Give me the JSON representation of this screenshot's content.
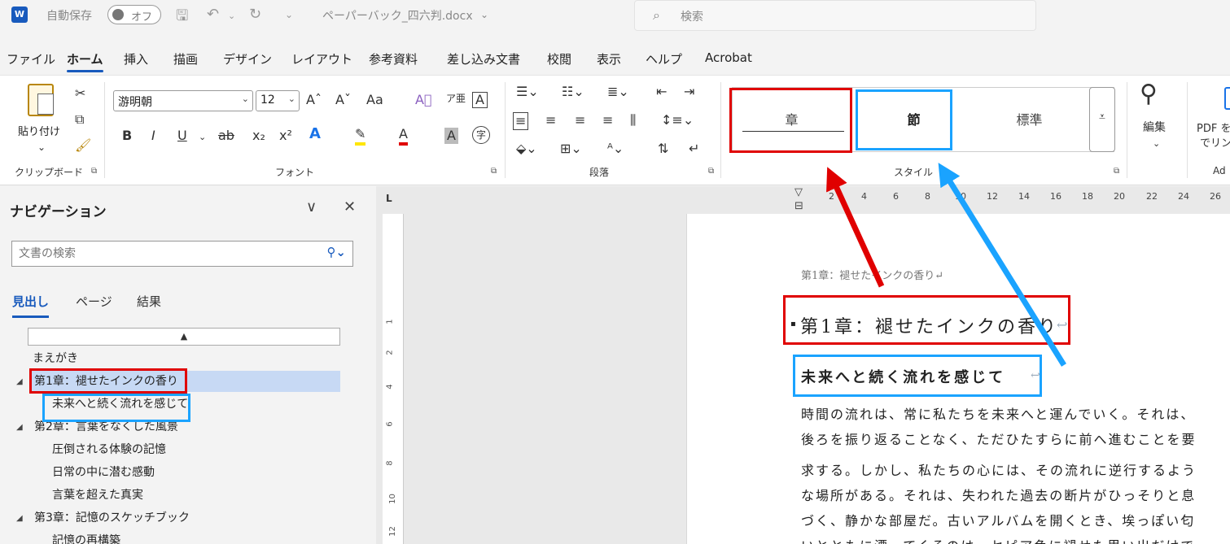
{
  "titlebar": {
    "app_logo": "W",
    "autosave_label": "自動保存",
    "autosave_state": "オフ",
    "filename": "ペーパーバック_四六判.docx",
    "search_placeholder": "検索"
  },
  "menu": {
    "tabs": [
      "ファイル",
      "ホーム",
      "挿入",
      "描画",
      "デザイン",
      "レイアウト",
      "参考資料",
      "差し込み文書",
      "校閲",
      "表示",
      "ヘルプ",
      "Acrobat"
    ],
    "active": "ホーム"
  },
  "ribbon": {
    "paste_label": "貼り付け",
    "clipboard_label": "クリップボード",
    "font_label": "フォント",
    "font_name": "游明朝",
    "font_size": "12",
    "paragraph_label": "段落",
    "styles_label": "スタイル",
    "style_chapter": "章",
    "style_section": "節",
    "style_normal": "標準",
    "edit_label": "編集",
    "pdf_label_1": "PDF を",
    "pdf_label_2": "でリン",
    "adobe_label": "Ad",
    "font_buttons": {
      "bold": "B",
      "italic": "I",
      "underline": "U",
      "strike": "ab",
      "subscript": "x₂",
      "superscript": "x²",
      "grow": "Aˆ",
      "shrink": "Aˇ",
      "case": "Aa",
      "font_color": "A",
      "char_shade": "A",
      "enclose": "字"
    }
  },
  "nav": {
    "title": "ナビゲーション",
    "search_placeholder": "文書の検索",
    "tabs": [
      "見出し",
      "ページ",
      "結果"
    ],
    "active_tab": "見出し",
    "collapse_symbol": "▲",
    "items": [
      {
        "label": "まえがき",
        "level": 1,
        "expandable": false
      },
      {
        "label": "第1章：褪せたインクの香り",
        "level": 1,
        "expandable": true,
        "selected": true
      },
      {
        "label": "未来へと続く流れを感じて",
        "level": 2,
        "expandable": false
      },
      {
        "label": "第2章：言葉をなくした風景",
        "level": 1,
        "expandable": true
      },
      {
        "label": "圧倒される体験の記憶",
        "level": 2,
        "expandable": false
      },
      {
        "label": "日常の中に潜む感動",
        "level": 2,
        "expandable": false
      },
      {
        "label": "言葉を超えた真実",
        "level": 2,
        "expandable": false
      },
      {
        "label": "第3章：記憶のスケッチブック",
        "level": 1,
        "expandable": true
      },
      {
        "label": "記憶の再構築",
        "level": 2,
        "expandable": false
      }
    ]
  },
  "ruler": {
    "top_numbers": [
      "2",
      "4",
      "6",
      "8",
      "10",
      "12",
      "14",
      "16",
      "18",
      "20",
      "22",
      "24",
      "26"
    ],
    "left_numbers": [
      "1",
      "2",
      "4",
      "6",
      "8",
      "10",
      "12"
    ],
    "tab_marker": "L"
  },
  "document": {
    "header": "第1章：褪せたインクの香り↵",
    "heading1": "第1章：褪せたインクの香り",
    "heading2": "未来へと続く流れを感じて",
    "return_mark": "↩",
    "body_lines": [
      "時間の流れは、常に私たちを未来へと運んでいく。それは、",
      "後ろを振り返ることなく、ただひたすらに前へ進むことを要",
      "求する。しかし、私たちの心には、その流れに逆行するよう",
      "な場所がある。それは、失われた過去の断片がひっそりと息",
      "づく、静かな部屋だ。古いアルバムを開くとき、埃っぽい匂",
      "いとともに漂ってくるのは、セピア色に褪せた思い出だけで"
    ]
  },
  "colors": {
    "highlight_red": "#e00000",
    "highlight_blue": "#1aa3ff",
    "accent": "#185abd"
  }
}
